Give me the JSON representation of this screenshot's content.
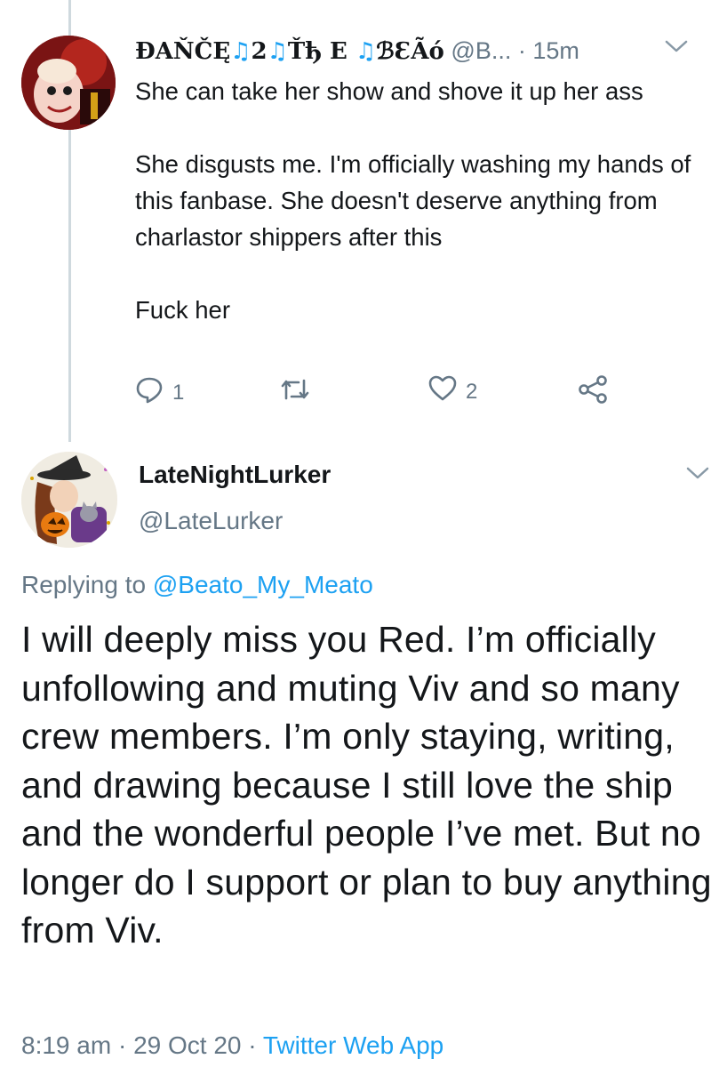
{
  "tweet1": {
    "display_name_parts": [
      "ĐAŇČĘ",
      "♫",
      "2",
      "♫",
      "Ťђ E ",
      "♫",
      "ℬƐÃó"
    ],
    "handle": "@B...",
    "time": "· 15m",
    "paragraphs": [
      "She can take her show and shove it up her ass",
      "She disgusts me. I'm officially washing my hands of this fanbase. She doesn't deserve anything from charlastor shippers after this",
      "Fuck her"
    ],
    "replies": "1",
    "likes": "2"
  },
  "tweet2": {
    "display_name": "LateNightLurker",
    "handle": "@LateLurker",
    "replying_prefix": "Replying to ",
    "replying_handle": "@Beato_My_Meato",
    "text": "I will deeply miss you Red. I’m officially unfollowing and muting Viv and so many crew members. I’m only staying, writing, and drawing because I still love the ship and the wonderful people I’ve met. But no longer do I support or plan to buy anything from Viv.",
    "time": "8:19 am",
    "sep1": " · ",
    "date": "29 Oct 20",
    "sep2": " · ",
    "source": "Twitter Web App"
  },
  "colors": {
    "accent": "#1da1f2",
    "secondary": "#657786",
    "line": "#cfd9de"
  },
  "icons": [
    "chevron-down-icon",
    "reply-icon",
    "retweet-icon",
    "like-icon",
    "share-icon"
  ]
}
